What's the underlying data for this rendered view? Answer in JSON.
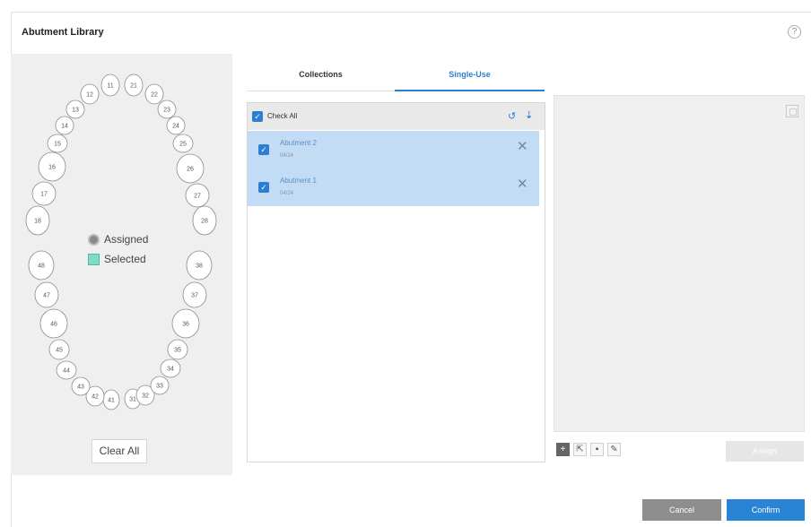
{
  "dialog": {
    "title": "Abutment Library",
    "help_glyph": "?"
  },
  "teeth": {
    "upper_right": [
      "11",
      "12",
      "13",
      "14",
      "15",
      "16",
      "17",
      "18"
    ],
    "upper_left": [
      "21",
      "22",
      "23",
      "24",
      "25",
      "26",
      "27",
      "28"
    ],
    "lower_left": [
      "31",
      "32",
      "33",
      "34",
      "35",
      "36",
      "37",
      "38"
    ],
    "lower_right": [
      "41",
      "42",
      "43",
      "44",
      "45",
      "46",
      "47",
      "48"
    ]
  },
  "legend": {
    "assigned": "Assigned",
    "selected": "Selected",
    "assigned_color": "#8a8a8a",
    "selected_color": "#7fdac7"
  },
  "clear_all": "Clear All",
  "tabs": [
    {
      "label": "Collections",
      "active": false
    },
    {
      "label": "Single-Use",
      "active": true
    }
  ],
  "list": {
    "check_all_label": "Check All",
    "items": [
      {
        "name": "Abutment 2",
        "date": "04/24",
        "checked": true
      },
      {
        "name": "Abutment 1",
        "date": "04/24",
        "checked": true
      }
    ]
  },
  "preview": {
    "assign_label": "Assign"
  },
  "footer": {
    "cancel": "Cancel",
    "confirm": "Confirm"
  },
  "colors": {
    "accent": "#2a7fd1",
    "selected_row": "#c3dcf5",
    "panel_bg": "#efefef"
  }
}
